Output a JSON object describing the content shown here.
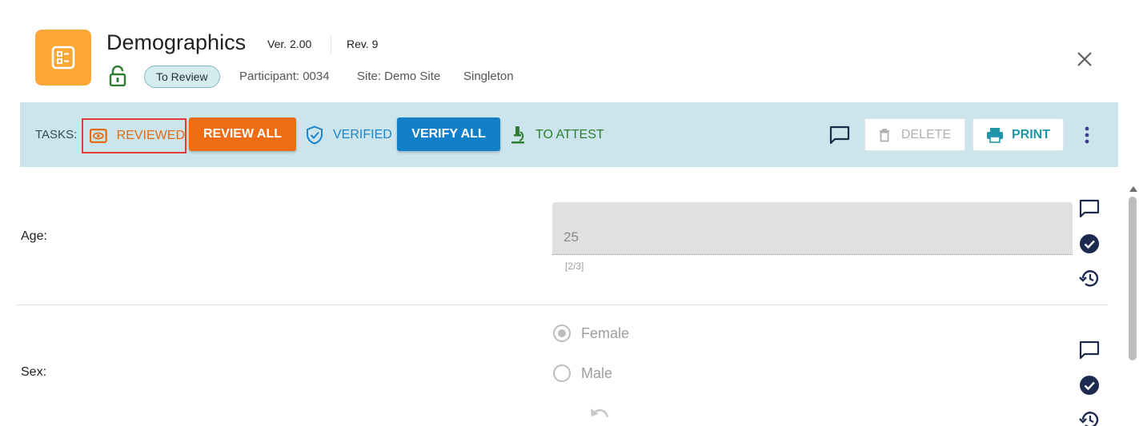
{
  "header": {
    "title": "Demographics",
    "version": "Ver. 2.00",
    "revision": "Rev. 9",
    "status": "To Review",
    "participant": "Participant: 0034",
    "site": "Site: Demo Site",
    "arm": "Singleton",
    "icons": {
      "form": "form-list-icon",
      "lock": "lock-open-icon",
      "close": "close-icon"
    }
  },
  "toolbar": {
    "tasks_label": "TASKS:",
    "reviewed_label": "REVIEWED",
    "review_all_label": "REVIEW ALL",
    "verified_label": "VERIFIED",
    "verify_all_label": "VERIFY ALL",
    "to_attest_label": "TO ATTEST",
    "delete_label": "DELETE",
    "print_label": "PRINT",
    "icons": {
      "reviewed": "eye-icon",
      "verified": "shield-check-icon",
      "attest": "microscope-icon",
      "comment": "comment-icon",
      "delete": "trash-icon",
      "print": "printer-icon",
      "more": "kebab-menu-icon"
    }
  },
  "colors": {
    "accent_orange": "#ee6c14",
    "accent_blue": "#1180c8",
    "attest_green": "#2e7d32",
    "toolbar_bg": "#cce5ec",
    "form_icon_bg": "#fea83a",
    "highlight_border": "#e53935"
  },
  "fields": {
    "age": {
      "label": "Age:",
      "value": "25",
      "counter": "[2/3]"
    },
    "sex": {
      "label": "Sex:",
      "options": [
        "Female",
        "Male"
      ],
      "selected": "Female"
    }
  }
}
